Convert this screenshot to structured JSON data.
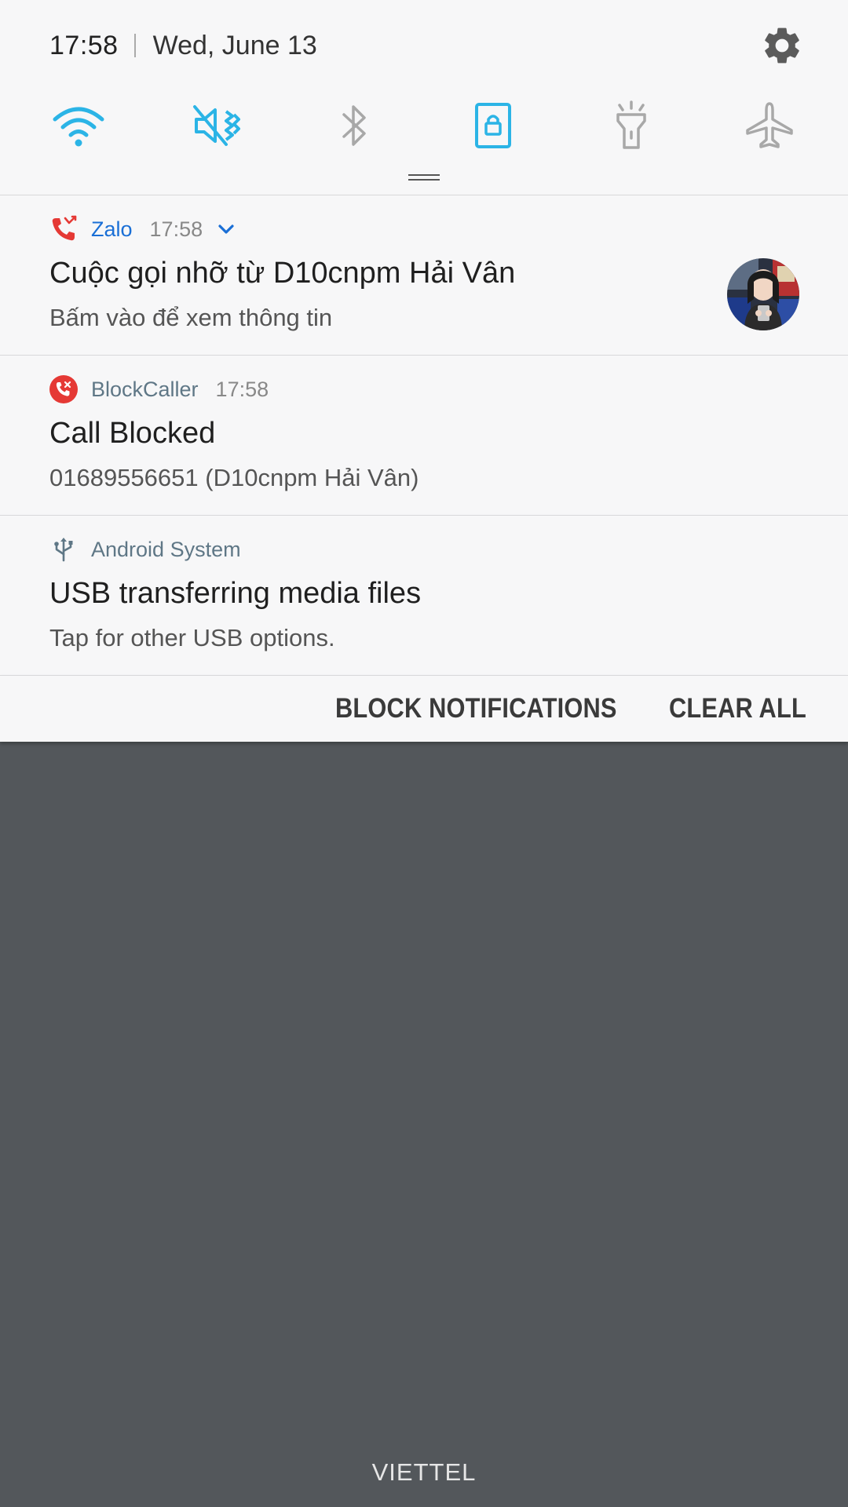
{
  "status": {
    "time": "17:58",
    "date": "Wed, June 13"
  },
  "quick_settings": [
    {
      "icon": "wifi-icon",
      "active": true
    },
    {
      "icon": "mute-vibrate-icon",
      "active": true
    },
    {
      "icon": "bluetooth-icon",
      "active": false
    },
    {
      "icon": "screen-rotation-lock-icon",
      "active": true
    },
    {
      "icon": "flashlight-icon",
      "active": false
    },
    {
      "icon": "airplane-mode-icon",
      "active": false
    }
  ],
  "notifications": [
    {
      "app": "Zalo",
      "time": "17:58",
      "title": "Cuộc gọi nhỡ từ D10cnpm Hải Vân",
      "body": "Bấm vào để xem thông tin"
    },
    {
      "app": "BlockCaller",
      "time": "17:58",
      "title": "Call Blocked",
      "body": "01689556651 (D10cnpm Hải Vân)"
    },
    {
      "app": "Android System",
      "title": "USB transferring media files",
      "body": "Tap for other USB options."
    }
  ],
  "actions": {
    "block_label": "BLOCK NOTIFICATIONS",
    "clear_label": "CLEAR ALL"
  },
  "carrier": "VIETTEL",
  "colors": {
    "accent": "#2bb4e6",
    "inactive_icon": "#a8a8a8",
    "zalo_blue": "#1a6fd6",
    "blockcaller_red": "#e53935",
    "backdrop": "#53575b"
  }
}
